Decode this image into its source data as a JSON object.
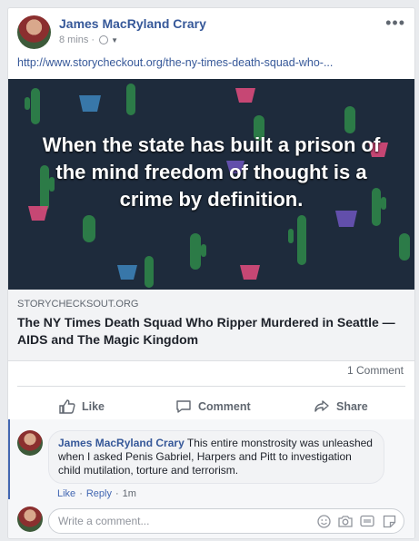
{
  "post": {
    "author": "James MacRyland Crary",
    "time": "8 mins",
    "separator": "·",
    "more_label": "•••",
    "url": "http://www.storycheckout.org/the-ny-times-death-squad-who-...",
    "image_quote": "When the state has built a prison of the mind freedom of thought is a crime by definition.",
    "link": {
      "domain": "STORYCHECKSOUT.ORG",
      "title": "The NY Times Death Squad Who Ripper Murdered in Seattle — AIDS and The Magic Kingdom"
    },
    "comment_count": "1 Comment"
  },
  "actions": {
    "like": "Like",
    "comment": "Comment",
    "share": "Share"
  },
  "comment": {
    "author": "James MacRyland Crary",
    "text": " This entire monstrosity was unleashed when I asked Penis Gabriel, Harpers and Pitt to investigation child mutilation, torture and terrorism.",
    "like": "Like",
    "reply": "Reply",
    "dot": "·",
    "time": "1m"
  },
  "composer": {
    "placeholder": "Write a comment..."
  },
  "icons": [
    "globe-icon",
    "caret-down-icon",
    "more-icon",
    "like-icon",
    "comment-icon",
    "share-icon",
    "emoji-icon",
    "camera-icon",
    "gif-icon",
    "sticker-icon"
  ],
  "colors": {
    "link": "#365899",
    "accent": "#4267b2",
    "image_bg": "#1e2b3c",
    "cactus": "#2f8a4a"
  }
}
